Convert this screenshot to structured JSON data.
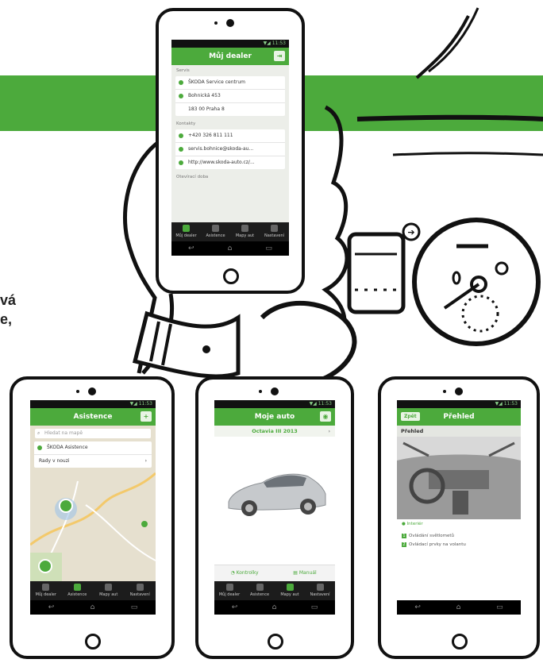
{
  "side_text": [
    "vá",
    "e,"
  ],
  "phone_top": {
    "status": "▼◢ 11:53",
    "title": "Můj dealer",
    "sections": [
      {
        "header": "Servis",
        "rows": [
          {
            "icon": "dealer-icon",
            "text": "ŠKODA Service centrum"
          },
          {
            "icon": "location-icon",
            "text": "Bohnická 453"
          },
          {
            "icon": "location-icon",
            "text": "183 00 Praha 8"
          }
        ]
      },
      {
        "header": "Kontakty",
        "rows": [
          {
            "icon": "phone-icon",
            "text": "+420 326 811 111"
          },
          {
            "icon": "email-icon",
            "text": "servis.bohnice@skoda-au..."
          },
          {
            "icon": "web-icon",
            "text": "http://www.skoda-auto.cz/..."
          }
        ]
      },
      {
        "header": "Otevírací doba",
        "rows": []
      }
    ],
    "tabs": [
      "Můj dealer",
      "Asistence",
      "Mapy aut",
      "Nastavení"
    ]
  },
  "phone_left": {
    "status": "▼◢ 11:53",
    "title": "Asistence",
    "search_placeholder": "Hledat na mapě",
    "rows": [
      {
        "icon": "phone-icon",
        "text": "ŠKODA Asistence"
      },
      {
        "icon": "chevron-right-icon",
        "text": "Rady v nouzi"
      }
    ],
    "tabs": [
      "Můj dealer",
      "Asistence",
      "Mapy aut",
      "Nastavení"
    ]
  },
  "phone_mid": {
    "status": "▼◢ 11:53",
    "title": "Moje auto",
    "subtitle": "Octavia III 2013",
    "buttons": [
      "Kontrolky",
      "Manuál"
    ],
    "tabs": [
      "Můj dealer",
      "Asistence",
      "Mapy aut",
      "Nastavení"
    ]
  },
  "phone_right": {
    "status": "▼◢ 11:53",
    "title": "Přehled",
    "back_label": "Zpět",
    "section": "Přehled",
    "legend": "Interiér",
    "items": [
      "Ovládání světlometů",
      "Ovládací prvky na volantu"
    ]
  },
  "colors": {
    "accent": "#4caa3c",
    "ink": "#111111",
    "screen_bg": "#eceee9"
  }
}
